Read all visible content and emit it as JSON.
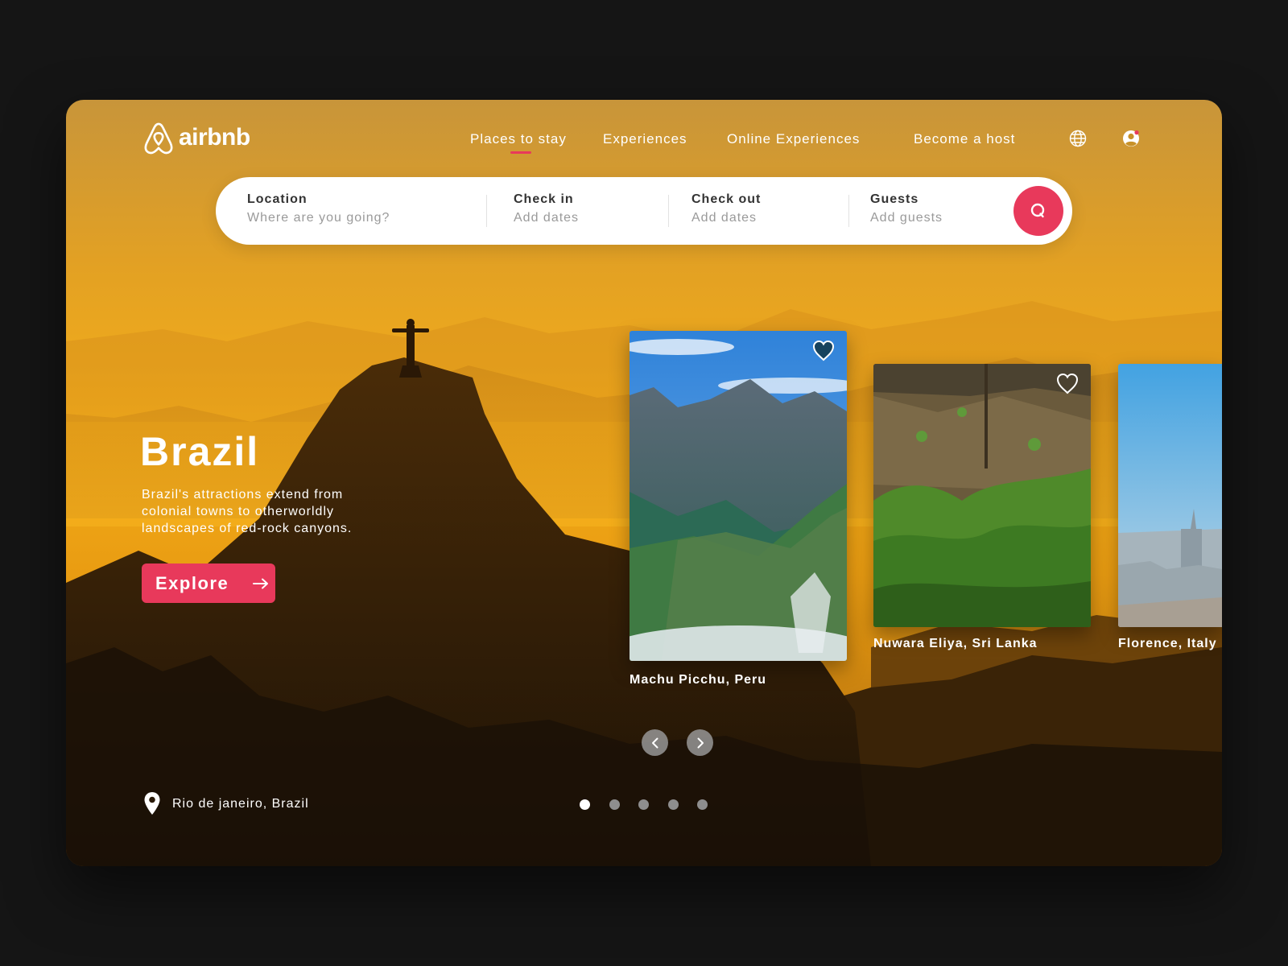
{
  "brand": {
    "name": "airbnb",
    "accent_color": "#e8395b"
  },
  "nav": {
    "links": [
      {
        "label": "Places to stay",
        "active": true
      },
      {
        "label": "Experiences",
        "active": false
      },
      {
        "label": "Online Experiences",
        "active": false
      },
      {
        "label": "Become a host",
        "active": false
      }
    ],
    "icons": [
      "globe-icon",
      "user-icon"
    ]
  },
  "search": {
    "location": {
      "label": "Location",
      "placeholder": "Where are you going?"
    },
    "check_in": {
      "label": "Check in",
      "placeholder": "Add dates"
    },
    "check_out": {
      "label": "Check out",
      "placeholder": "Add dates"
    },
    "guests": {
      "label": "Guests",
      "placeholder": "Add guests"
    },
    "button_icon": "search-icon"
  },
  "hero": {
    "title": "Brazil",
    "description": "Brazil's attractions extend from colonial towns to otherworldly landscapes of red-rock canyons.",
    "cta_label": "Explore",
    "cta_icon": "arrow-right-icon"
  },
  "cards": [
    {
      "caption": "Machu Picchu, Peru",
      "favorited": true
    },
    {
      "caption": "Nuwara Eliya, Sri Lanka",
      "favorited": false
    },
    {
      "caption": "Florence, Italy",
      "favorited": false
    }
  ],
  "carousel": {
    "prev_icon": "chevron-left-icon",
    "next_icon": "chevron-right-icon",
    "slides": 5,
    "active_index": 0
  },
  "current_location": {
    "icon": "map-pin-icon",
    "text": "Rio de janeiro, Brazil"
  }
}
